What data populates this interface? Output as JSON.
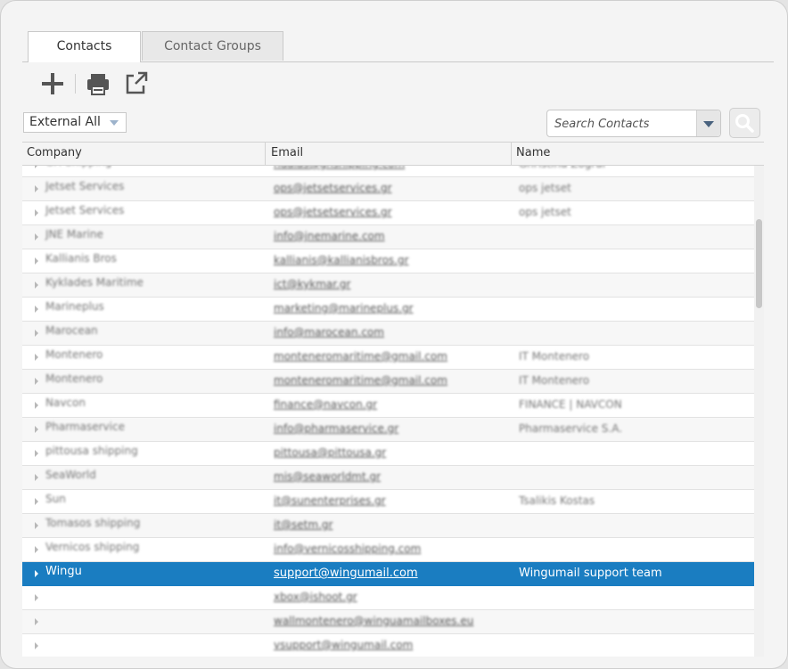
{
  "tabs": [
    {
      "label": "Contacts",
      "active": true
    },
    {
      "label": "Contact Groups",
      "active": false
    }
  ],
  "toolbar": {
    "add_icon": "plus-icon",
    "print_icon": "printer-icon",
    "export_icon": "external-link-icon"
  },
  "filter": {
    "selected": "External All"
  },
  "search": {
    "placeholder": "Search Contacts",
    "value": ""
  },
  "grid": {
    "columns": {
      "company": "Company",
      "email": "Email",
      "name": "Name"
    },
    "rows": [
      {
        "company": "GH Shipping",
        "email": "hdalas@ghshipping.com",
        "name": "Ghristina Zograi"
      },
      {
        "company": "Jetset Services",
        "email": "ops@jetsetservices.gr",
        "name": "ops jetset"
      },
      {
        "company": "Jetset Services",
        "email": "ops@jetsetservices.gr",
        "name": "ops jetset"
      },
      {
        "company": "JNE Marine",
        "email": "info@jnemarine.com",
        "name": ""
      },
      {
        "company": "Kallianis Bros",
        "email": "kallianis@kallianisbros.gr",
        "name": ""
      },
      {
        "company": "Kyklades Maritime",
        "email": "ict@kykmar.gr",
        "name": ""
      },
      {
        "company": "Marineplus",
        "email": "marketing@marineplus.gr",
        "name": ""
      },
      {
        "company": "Marocean",
        "email": "info@marocean.com",
        "name": ""
      },
      {
        "company": "Montenero",
        "email": "monteneromaritime@gmail.com",
        "name": "IT Montenero"
      },
      {
        "company": "Montenero",
        "email": "monteneromaritime@gmail.com",
        "name": "IT Montenero"
      },
      {
        "company": "Navcon",
        "email": "finance@navcon.gr",
        "name": "FINANCE | NAVCON"
      },
      {
        "company": "Pharmaservice",
        "email": "info@pharmaservice.gr",
        "name": "Pharmaservice S.A."
      },
      {
        "company": "pittousa shipping",
        "email": "pittousa@pittousa.gr",
        "name": ""
      },
      {
        "company": "SeaWorld",
        "email": "mis@seaworldmt.gr",
        "name": ""
      },
      {
        "company": "Sun",
        "email": "it@sunenterprises.gr",
        "name": "Tsalikis Kostas"
      },
      {
        "company": "Tomasos shipping",
        "email": "it@setm.gr",
        "name": ""
      },
      {
        "company": "Vernicos shipping",
        "email": "info@vernicosshipping.com",
        "name": ""
      },
      {
        "company": "Wingu",
        "email": "support@wingumail.com",
        "name": "Wingumail support team",
        "selected": true
      },
      {
        "company": "",
        "email": "xbox@ishoot.gr",
        "name": ""
      },
      {
        "company": "",
        "email": "wallmontenero@winguamailboxes.eu",
        "name": ""
      },
      {
        "company": "",
        "email": "vsupport@wingumail.com",
        "name": ""
      }
    ]
  }
}
